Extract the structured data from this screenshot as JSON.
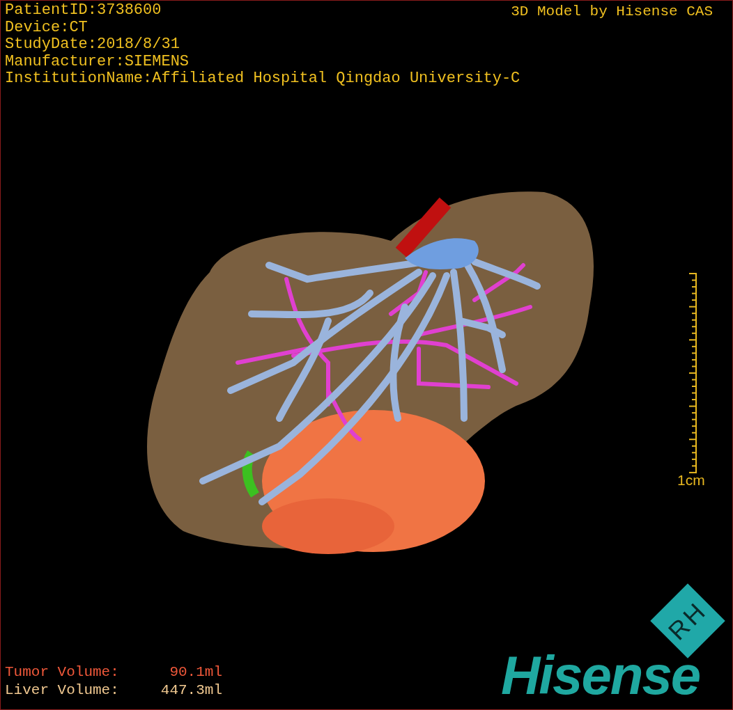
{
  "info_lines": [
    "PatientID:3738600",
    "Device:CT",
    "StudyDate:2018/8/31",
    "Manufacturer:SIEMENS",
    "InstitutionName:Affiliated Hospital Qingdao University-C"
  ],
  "caption": "3D Model by Hisense CAS",
  "scale": {
    "label": "1cm"
  },
  "volumes": [
    {
      "kind": "tumor",
      "label": "Tumor Volume:",
      "value": "90.1ml"
    },
    {
      "kind": "liver",
      "label": "Liver Volume:",
      "value": "447.3ml"
    }
  ],
  "logo": {
    "badge": "RH",
    "wordmark": "Hisense"
  }
}
